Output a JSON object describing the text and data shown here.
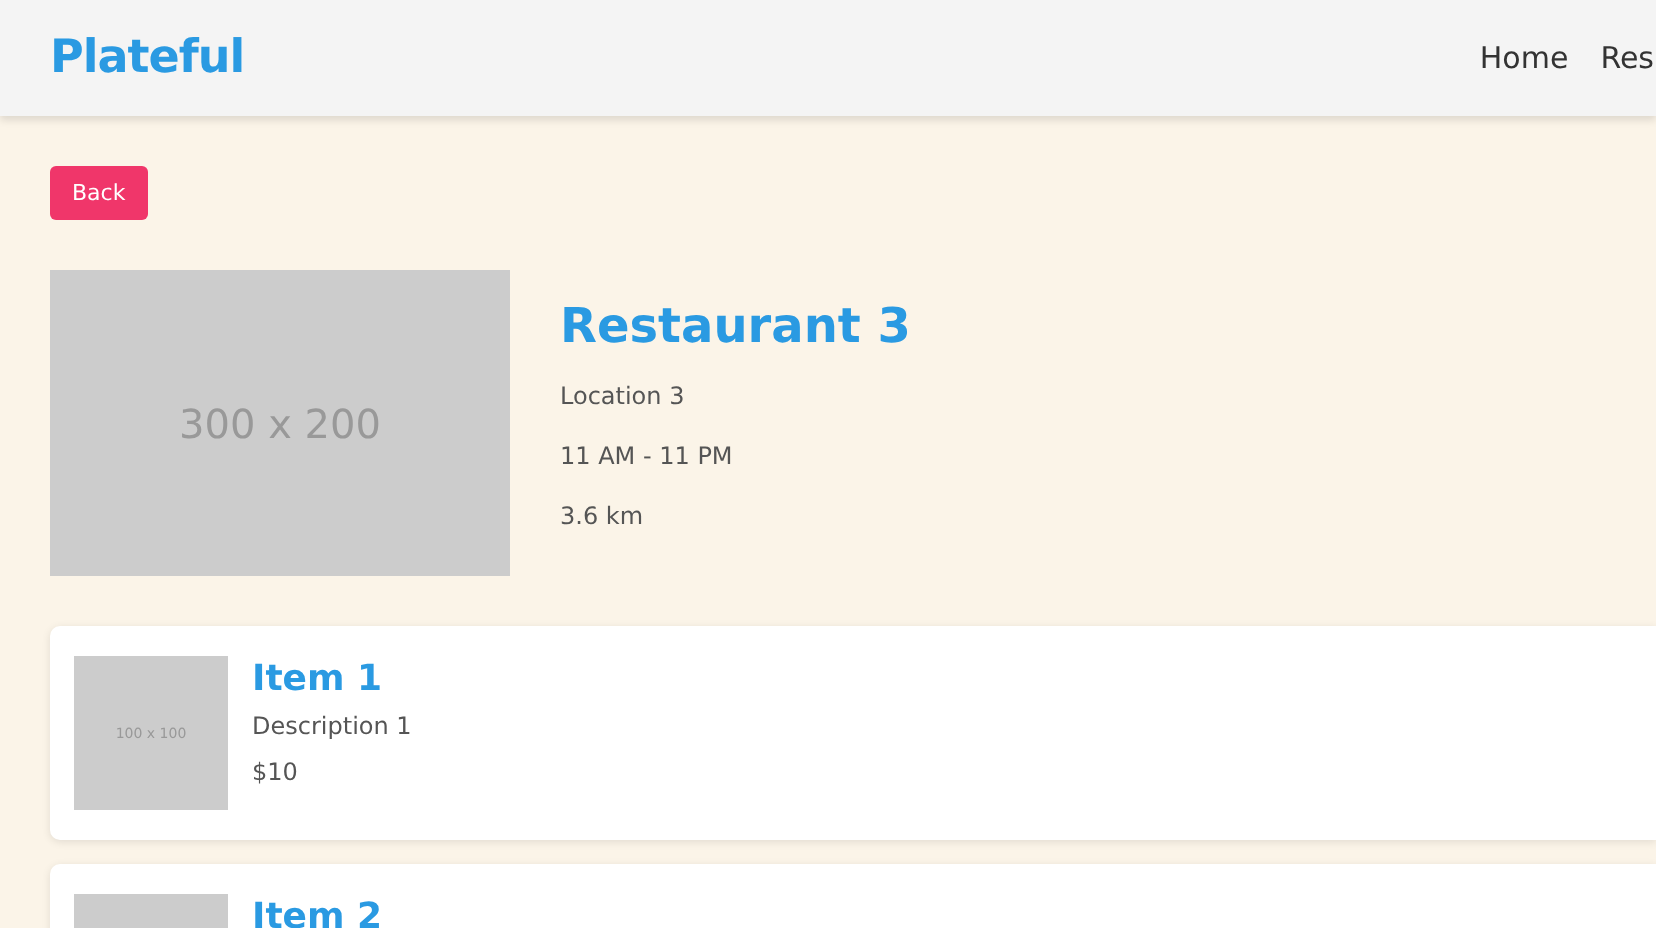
{
  "header": {
    "logo": "Plateful",
    "nav": [
      {
        "label": "Home"
      },
      {
        "label": "Res"
      }
    ]
  },
  "back_button": "Back",
  "restaurant": {
    "image_label": "300 x 200",
    "name": "Restaurant 3",
    "details": [
      "Location 3",
      "11 AM - 11 PM",
      "3.6 km"
    ]
  },
  "menu_items": [
    {
      "image_label": "100 x 100",
      "title": "Item 1",
      "description": "Description 1",
      "price": "$10"
    },
    {
      "title": "Item 2"
    }
  ]
}
